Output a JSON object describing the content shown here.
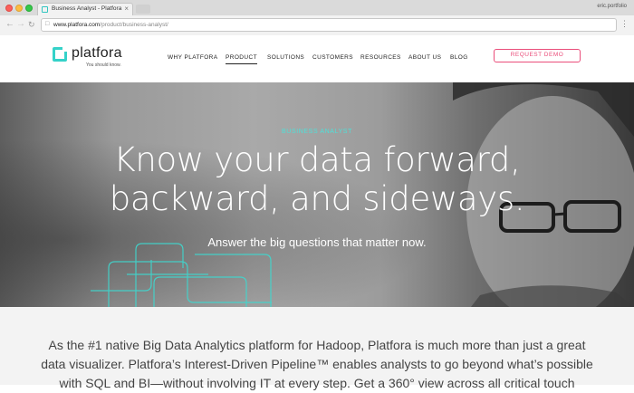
{
  "browser": {
    "tab_title": "Business Analyst - Platfora",
    "profile": "eric.portfolio",
    "url_host": "www.platfora.com",
    "url_path": "/product/business-analyst/",
    "tab_close": "×",
    "menu_dots": "⋮"
  },
  "site": {
    "logo_name": "platfora",
    "logo_tagline": "You should know.",
    "nav": [
      {
        "label": "WHY PLATFORA"
      },
      {
        "label": "PRODUCT"
      },
      {
        "label": "SOLUTIONS"
      },
      {
        "label": "CUSTOMERS"
      },
      {
        "label": "RESOURCES"
      },
      {
        "label": "ABOUT US"
      },
      {
        "label": "BLOG"
      }
    ],
    "cta": "REQUEST DEMO",
    "accent": "#35d2c9",
    "cta_color": "#ea4d7a"
  },
  "hero": {
    "eyebrow": "BUSINESS ANALYST",
    "title_line1": "Know your data forward,",
    "title_line2": "backward, and sideways.",
    "subtitle": "Answer the big questions that matter now."
  },
  "body": {
    "paragraph": "As the #1 native Big Data Analytics platform for Hadoop, Platfora is much more than just a great data visualizer. Platfora’s Interest-Driven Pipeline™ enables analysts to go beyond what’s possible with SQL and BI—without involving IT at every step. Get a 360° view across all critical touch"
  }
}
